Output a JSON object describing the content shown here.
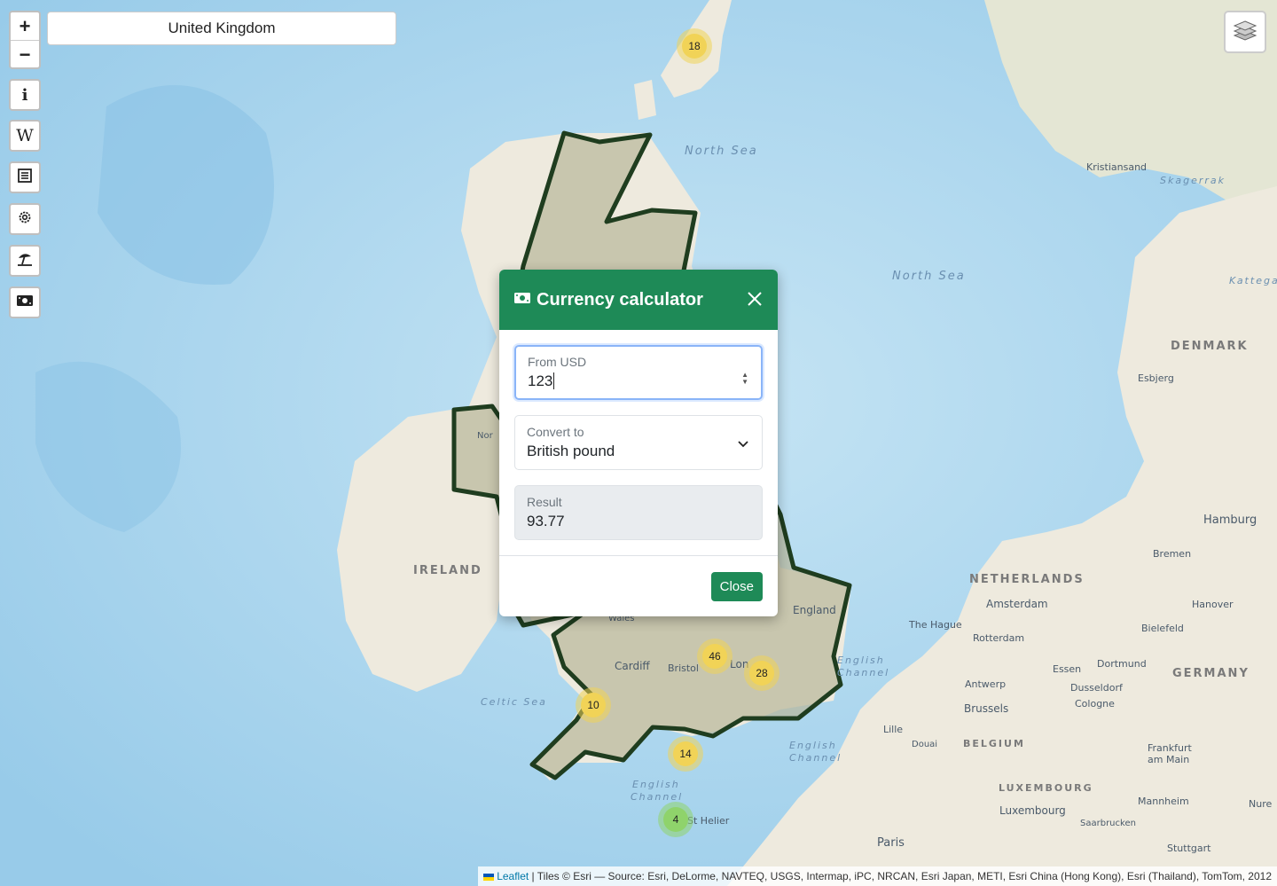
{
  "search": {
    "value": "United Kingdom"
  },
  "controls": {
    "zoom_in": "+",
    "zoom_out": "−",
    "tools": [
      {
        "name": "info-icon",
        "glyph": "i"
      },
      {
        "name": "wikipedia-icon",
        "glyph": "W"
      },
      {
        "name": "news-icon",
        "glyph": ""
      },
      {
        "name": "settings-gear-icon",
        "glyph": ""
      },
      {
        "name": "beach-umbrella-icon",
        "glyph": ""
      },
      {
        "name": "money-icon",
        "glyph": ""
      }
    ]
  },
  "clusters": [
    {
      "label": "18",
      "level": "medium"
    },
    {
      "label": "46",
      "level": "medium"
    },
    {
      "label": "28",
      "level": "medium"
    },
    {
      "label": "10",
      "level": "medium"
    },
    {
      "label": "14",
      "level": "medium"
    },
    {
      "label": "4",
      "level": "small"
    }
  ],
  "map_labels": {
    "north_sea_1": "North  Sea",
    "north_sea_2": "North  Sea",
    "skagerrak": "Skagerrak",
    "kattegat": "Kattegat",
    "kristiansand": "Kristiansand",
    "denmark": "DENMARK",
    "esbjerg": "Esbjerg",
    "hamburg": "Hamburg",
    "bremen": "Bremen",
    "netherlands": "NETHERLANDS",
    "amsterdam": "Amsterdam",
    "hanover": "Hanover",
    "the_hague": "The Hague",
    "rotterdam": "Rotterdam",
    "bielefeld": "Bielefeld",
    "essen": "Essen",
    "dortmund": "Dortmund",
    "germany": "GERMANY",
    "antwerp": "Antwerp",
    "dusseldorf": "Dusseldorf",
    "cologne": "Cologne",
    "brussels": "Brussels",
    "lille": "Lille",
    "douai": "Douai",
    "belgium": "BELGIUM",
    "frankfurt_1": "Frankfurt",
    "frankfurt_2": "am Main",
    "luxembourg_country": "LUXEMBOURG",
    "luxembourg_city": "Luxembourg",
    "mannheim": "Mannheim",
    "nuremberg": "Nure",
    "saarbrucken": "Saarbrucken",
    "stuttgart": "Stuttgart",
    "paris": "Paris",
    "ireland": "IRELAND",
    "celtic_sea": "Celtic Sea",
    "english_channel_1a": "English",
    "english_channel_1b": "Channel",
    "english_channel_2a": "English",
    "english_channel_2b": "Channel",
    "english_channel_3a": "English",
    "english_channel_3b": "Channel",
    "england": "England",
    "wales": "Wales",
    "cardiff": "Cardiff",
    "bristol": "Bristol",
    "london": "Lon",
    "st_helier": "St Helier",
    "northern_ireland": "Nor"
  },
  "modal": {
    "title": "Currency calculator",
    "from_label": "From USD",
    "from_value": "123",
    "to_label": "Convert to",
    "to_value": "British pound",
    "result_label": "Result",
    "result_value": "93.77",
    "close_button": "Close"
  },
  "attribution": {
    "leaflet": "Leaflet",
    "text": " | Tiles © Esri — Source: Esri, DeLorme, NAVTEQ, USGS, Intermap, iPC, NRCAN, Esri Japan, METI, Esri China (Hong Kong), Esri (Thailand), TomTom, 2012"
  },
  "colors": {
    "sea": "#a9d6f0",
    "land": "#eeeade",
    "uk_fill": "#b8b79a",
    "uk_border": "#1f3d1f",
    "cluster_medium": "#f1d357",
    "cluster_small": "#8fd36b",
    "accent": "#1e8a57"
  }
}
